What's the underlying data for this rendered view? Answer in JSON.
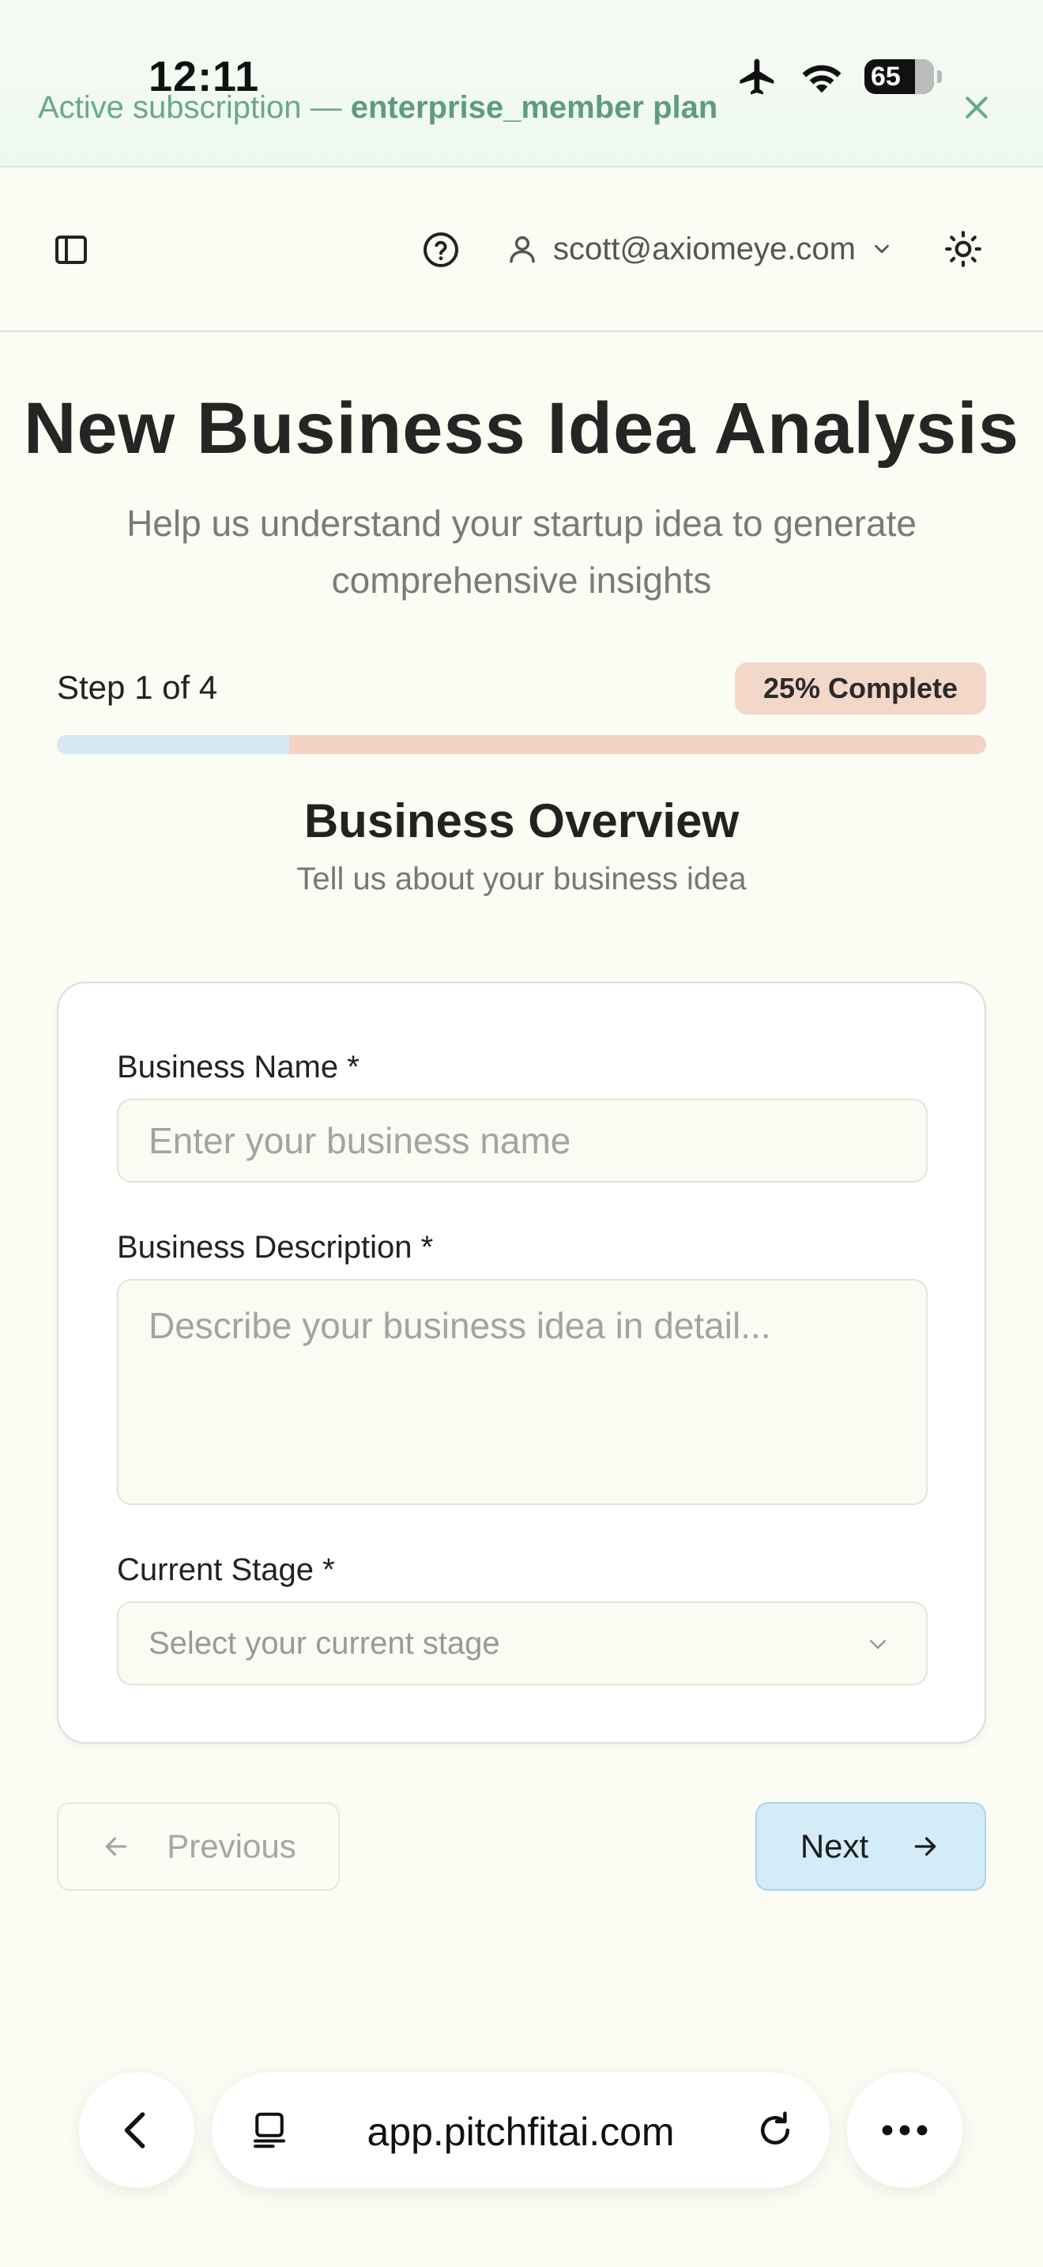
{
  "status_bar": {
    "time": "12:11",
    "battery": "65"
  },
  "banner": {
    "prefix": "Active subscription — ",
    "plan": "enterprise_member plan"
  },
  "header": {
    "user_email": "scott@axiomeye.com"
  },
  "page": {
    "title": "New Business Idea Analysis",
    "subtitle": "Help us understand your startup idea to generate comprehensive insights"
  },
  "progress": {
    "step_label": "Step 1 of 4",
    "badge": "25% Complete",
    "percent": 25
  },
  "section": {
    "title": "Business Overview",
    "subtitle": "Tell us about your business idea"
  },
  "form": {
    "business_name_label": "Business Name *",
    "business_name_placeholder": "Enter your business name",
    "business_name_value": "",
    "business_description_label": "Business Description *",
    "business_description_placeholder": "Describe your business idea in detail...",
    "business_description_value": "",
    "current_stage_label": "Current Stage *",
    "current_stage_placeholder": "Select your current stage"
  },
  "nav": {
    "previous_label": "Previous",
    "next_label": "Next"
  },
  "browser": {
    "url": "app.pitchfitai.com"
  },
  "colors": {
    "background": "#fbfcf3",
    "banner_text": "#6aa88a",
    "progress_done": "#d5eaf5",
    "progress_remaining": "#f2d3c4",
    "next_button": "#d4ebf8"
  }
}
